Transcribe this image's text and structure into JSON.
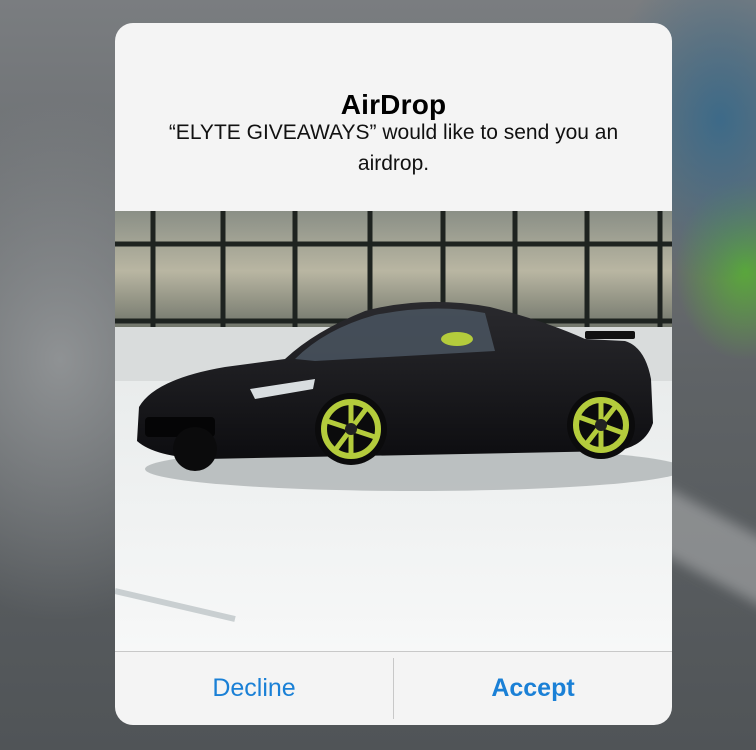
{
  "dialog": {
    "title": "AirDrop",
    "message": "“ELYTE GIVEAWAYS” would like to send you an airdrop.",
    "decline_label": "Decline",
    "accept_label": "Accept"
  },
  "image": {
    "subject": "black sports car with green wheels"
  },
  "colors": {
    "button_text": "#1a80d6",
    "dialog_bg": "#f4f4f4",
    "wheel_accent": "#b4cc3c"
  }
}
